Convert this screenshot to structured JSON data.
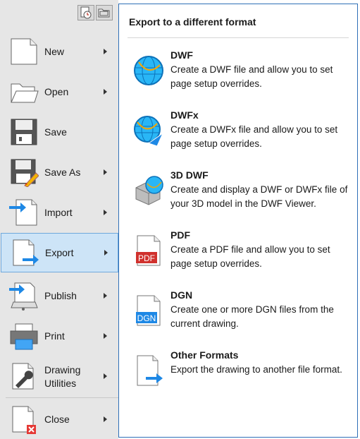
{
  "menu": {
    "items": [
      {
        "id": "new",
        "label": "New"
      },
      {
        "id": "open",
        "label": "Open"
      },
      {
        "id": "save",
        "label": "Save"
      },
      {
        "id": "saveas",
        "label": "Save As"
      },
      {
        "id": "import",
        "label": "Import"
      },
      {
        "id": "export",
        "label": "Export"
      },
      {
        "id": "publish",
        "label": "Publish"
      },
      {
        "id": "print",
        "label": "Print"
      },
      {
        "id": "drawing_utilities",
        "label": "Drawing Utilities"
      },
      {
        "id": "close",
        "label": "Close"
      }
    ],
    "drawing_utilities_line1": "Drawing",
    "drawing_utilities_line2": "Utilities",
    "active": "Export"
  },
  "panel": {
    "title": "Export to a different format",
    "options": [
      {
        "name": "DWF",
        "description": "Create a DWF file and allow you to set page setup overrides."
      },
      {
        "name": "DWFx",
        "description": "Create a DWFx file and allow you to set page setup overrides."
      },
      {
        "name": "3D DWF",
        "description": "Create and display a DWF or DWFx file of your 3D model in the DWF Viewer."
      },
      {
        "name": "PDF",
        "description": "Create a PDF file and allow you to set page setup overrides."
      },
      {
        "name": "DGN",
        "description": "Create one or more DGN files from the current drawing."
      },
      {
        "name": "Other Formats",
        "description": "Export the drawing to another file format."
      }
    ],
    "pdf_icon_text": "PDF",
    "dgn_icon_text": "DGN"
  },
  "colors": {
    "accent_border": "#2e6fb7",
    "active_bg": "#cde4f7",
    "arrow_blue": "#1e88e5",
    "pdf_red": "#d0312d",
    "close_red": "#e53935"
  }
}
